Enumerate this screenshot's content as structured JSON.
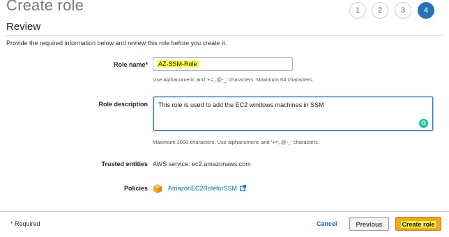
{
  "header": {
    "title": "Create role",
    "steps": [
      {
        "label": "1",
        "active": false
      },
      {
        "label": "2",
        "active": false
      },
      {
        "label": "3",
        "active": false
      },
      {
        "label": "4",
        "active": true
      }
    ]
  },
  "review": {
    "section_title": "Review",
    "description": "Provide the required information below and review this role before you create it."
  },
  "form": {
    "role_name": {
      "label": "Role name*",
      "value": "AZ-SSM-Role",
      "hint": "Use alphanumeric and '+=,.@-_' characters. Maximum 64 characters."
    },
    "role_description": {
      "label": "Role description",
      "value": "This role is used to add the EC2 windows machines in SSM",
      "hint": "Maximum 1000 characters. Use alphanumeric and '+=,.@-_' characters."
    },
    "trusted_entities": {
      "label": "Trusted entities",
      "value": "AWS service: ec2.amazonaws.com"
    },
    "policies": {
      "label": "Policies",
      "items": [
        "AmazonEC2RoleforSSM"
      ]
    }
  },
  "footer": {
    "required_note": "* Required",
    "cancel_label": "Cancel",
    "previous_label": "Previous",
    "create_label": "Create role"
  },
  "colors": {
    "accent_blue": "#2b6fb6",
    "link": "#0073bb",
    "create_button": "#f2a623",
    "highlight": "#ffff3a"
  }
}
